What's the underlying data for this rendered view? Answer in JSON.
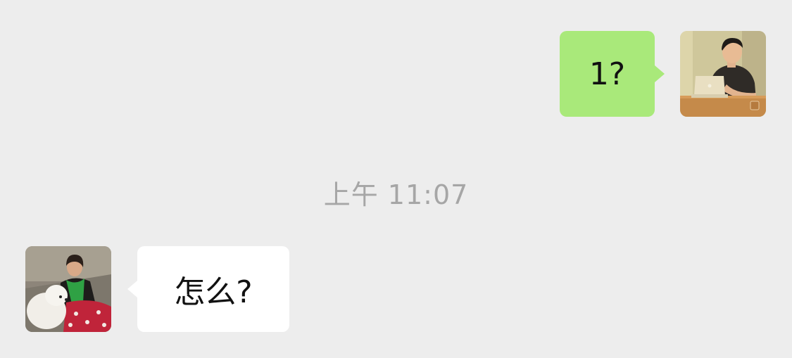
{
  "conversation": {
    "messages": [
      {
        "sender": "self",
        "text": "1?",
        "avatar": "avatar-man-with-laptop"
      },
      {
        "sender": "other",
        "text": "怎么?",
        "avatar": "avatar-woman-with-dog"
      }
    ],
    "timestamp": "上午 11:07"
  },
  "colors": {
    "background": "#ededed",
    "outgoing_bubble": "#a9e97a",
    "incoming_bubble": "#ffffff",
    "timestamp_text": "#a6a6a6"
  }
}
